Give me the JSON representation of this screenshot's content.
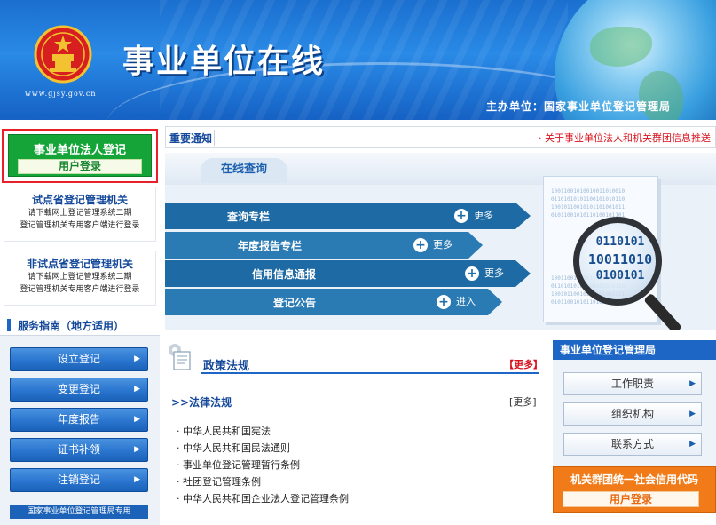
{
  "header": {
    "site_title": "事业单位在线",
    "url": "www.gjsy.gov.cn",
    "sponsor": "主办单位：国家事业单位登记管理局",
    "emblem_icon": "national-emblem-icon"
  },
  "login": {
    "title": "事业单位法人登记",
    "button": "用户登录"
  },
  "pilot_reg": {
    "title": "试点省登记管理机关",
    "line1": "请下载网上登记管理系统二期",
    "line2": "登记管理机关专用客户端进行登录"
  },
  "nonpilot_reg": {
    "title": "非试点省登记管理机关",
    "line1": "请下载网上登记管理系统二期",
    "line2": "登记管理机关专用客户端进行登录"
  },
  "service": {
    "title": "服务指南（地方适用）",
    "buttons": [
      "设立登记",
      "变更登记",
      "年度报告",
      "证书补领",
      "注销登记"
    ],
    "bottom_strip": "国家事业单位登记管理局专用"
  },
  "notice": {
    "label": "重要通知",
    "text": "· 关于事业单位法人和机关群团信息推送"
  },
  "query": {
    "tab": "在线查询",
    "items": [
      {
        "label": "查询专栏",
        "action": "更多"
      },
      {
        "label": "年度报告专栏",
        "action": "更多"
      },
      {
        "label": "信用信息通报",
        "action": "更多"
      },
      {
        "label": "登记公告",
        "action": "进入"
      }
    ],
    "lens_lines": [
      "0110101",
      "10011010",
      "0100101"
    ]
  },
  "policy": {
    "title": "政策法规",
    "more": "【更多】",
    "law_head": ">>法律法规",
    "law_more": "[更多]",
    "laws": [
      "中华人民共和国宪法",
      "中华人民共和国民法通则",
      "事业单位登记管理暂行条例",
      "社团登记管理条例",
      "中华人民共和国企业法人登记管理条例"
    ]
  },
  "bureau": {
    "title": "事业单位登记管理局",
    "buttons": [
      "工作职责",
      "组织机构",
      "联系方式"
    ]
  },
  "org_code": {
    "title": "机关群团统一社会信用代码",
    "button": "用户登录"
  },
  "colors": {
    "primary_blue": "#1e66c6",
    "login_green": "#15a437",
    "alert_red": "#d8121d",
    "org_orange": "#f07b18"
  }
}
